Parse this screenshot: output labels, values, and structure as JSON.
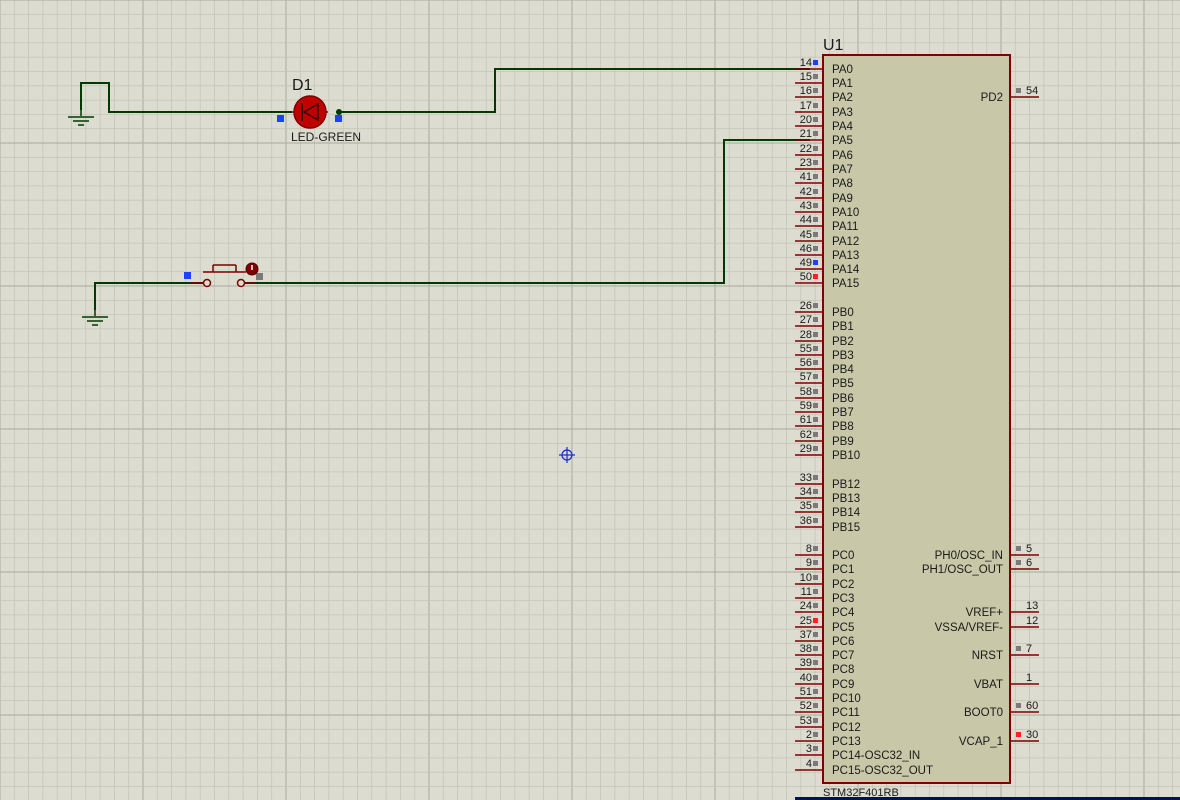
{
  "colors": {
    "background": "#dcdcd0",
    "grid_minor": "#c5c5b8",
    "grid_major": "#b2b2a5",
    "wire": "#003a00",
    "component_outline": "#800000",
    "chip_body": "#c8c8a8",
    "pin_marker_gray": "#7a7a7a",
    "pin_marker_blue": "#2040ff",
    "pin_marker_red": "#ff2020",
    "led": "#c00000",
    "cursor": "#1030c0",
    "bottom_bar": "#001060"
  },
  "icons": [
    "ground-icon",
    "led-icon",
    "push-button-icon",
    "origin-cursor-icon"
  ],
  "led": {
    "ref": "D1",
    "value": "LED-GREEN"
  },
  "chip": {
    "ref": "U1",
    "part": "STM32F401RB",
    "left_pins": [
      {
        "num": "14",
        "name": "PA0",
        "marker": "blue"
      },
      {
        "num": "15",
        "name": "PA1",
        "marker": "gray"
      },
      {
        "num": "16",
        "name": "PA2",
        "marker": "gray"
      },
      {
        "num": "17",
        "name": "PA3",
        "marker": "gray"
      },
      {
        "num": "20",
        "name": "PA4",
        "marker": "gray"
      },
      {
        "num": "21",
        "name": "PA5",
        "marker": "gray"
      },
      {
        "num": "22",
        "name": "PA6",
        "marker": "gray"
      },
      {
        "num": "23",
        "name": "PA7",
        "marker": "gray"
      },
      {
        "num": "41",
        "name": "PA8",
        "marker": "gray"
      },
      {
        "num": "42",
        "name": "PA9",
        "marker": "gray"
      },
      {
        "num": "43",
        "name": "PA10",
        "marker": "gray"
      },
      {
        "num": "44",
        "name": "PA11",
        "marker": "gray"
      },
      {
        "num": "45",
        "name": "PA12",
        "marker": "gray"
      },
      {
        "num": "46",
        "name": "PA13",
        "marker": "gray"
      },
      {
        "num": "49",
        "name": "PA14",
        "marker": "blue"
      },
      {
        "num": "50",
        "name": "PA15",
        "marker": "red"
      },
      {
        "num": "26",
        "name": "PB0",
        "marker": "gray"
      },
      {
        "num": "27",
        "name": "PB1",
        "marker": "gray"
      },
      {
        "num": "28",
        "name": "PB2",
        "marker": "gray"
      },
      {
        "num": "55",
        "name": "PB3",
        "marker": "gray"
      },
      {
        "num": "56",
        "name": "PB4",
        "marker": "gray"
      },
      {
        "num": "57",
        "name": "PB5",
        "marker": "gray"
      },
      {
        "num": "58",
        "name": "PB6",
        "marker": "gray"
      },
      {
        "num": "59",
        "name": "PB7",
        "marker": "gray"
      },
      {
        "num": "61",
        "name": "PB8",
        "marker": "gray"
      },
      {
        "num": "62",
        "name": "PB9",
        "marker": "gray"
      },
      {
        "num": "29",
        "name": "PB10",
        "marker": "gray"
      },
      {
        "num": "33",
        "name": "PB12",
        "marker": "gray"
      },
      {
        "num": "34",
        "name": "PB13",
        "marker": "gray"
      },
      {
        "num": "35",
        "name": "PB14",
        "marker": "gray"
      },
      {
        "num": "36",
        "name": "PB15",
        "marker": "gray"
      },
      {
        "num": "8",
        "name": "PC0",
        "marker": "gray"
      },
      {
        "num": "9",
        "name": "PC1",
        "marker": "gray"
      },
      {
        "num": "10",
        "name": "PC2",
        "marker": "gray"
      },
      {
        "num": "11",
        "name": "PC3",
        "marker": "gray"
      },
      {
        "num": "24",
        "name": "PC4",
        "marker": "gray"
      },
      {
        "num": "25",
        "name": "PC5",
        "marker": "red"
      },
      {
        "num": "37",
        "name": "PC6",
        "marker": "gray"
      },
      {
        "num": "38",
        "name": "PC7",
        "marker": "gray"
      },
      {
        "num": "39",
        "name": "PC8",
        "marker": "gray"
      },
      {
        "num": "40",
        "name": "PC9",
        "marker": "gray"
      },
      {
        "num": "51",
        "name": "PC10",
        "marker": "gray"
      },
      {
        "num": "52",
        "name": "PC11",
        "marker": "gray"
      },
      {
        "num": "53",
        "name": "PC12",
        "marker": "gray"
      },
      {
        "num": "2",
        "name": "PC13",
        "marker": "gray"
      },
      {
        "num": "3",
        "name": "PC14-OSC32_IN",
        "marker": "gray"
      },
      {
        "num": "4",
        "name": "PC15-OSC32_OUT",
        "marker": "gray"
      }
    ],
    "right_pins": [
      {
        "num": "54",
        "name": "PD2",
        "marker": "gray"
      },
      {
        "num": "5",
        "name": "PH0/OSC_IN",
        "marker": "gray"
      },
      {
        "num": "6",
        "name": "PH1/OSC_OUT",
        "marker": "gray"
      },
      {
        "num": "13",
        "name": "VREF+",
        "marker": "none"
      },
      {
        "num": "12",
        "name": "VSSA/VREF-",
        "marker": "none"
      },
      {
        "num": "7",
        "name": "NRST",
        "marker": "gray"
      },
      {
        "num": "1",
        "name": "VBAT",
        "marker": "none"
      },
      {
        "num": "60",
        "name": "BOOT0",
        "marker": "gray"
      },
      {
        "num": "30",
        "name": "VCAP_1",
        "marker": "red"
      }
    ]
  }
}
